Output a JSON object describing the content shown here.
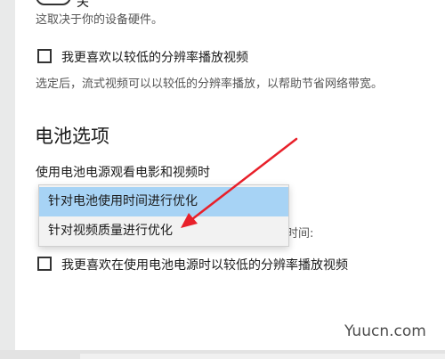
{
  "settings": {
    "toggle_state": "关",
    "hardware_note": "这取决于你的设备硬件。",
    "low_res_checkbox_label": "我更喜欢以较低的分辨率播放视频",
    "low_res_description": "选定后，流式视频可以以较低的分辨率播放，以帮助节省网络带宽。"
  },
  "battery": {
    "heading": "电池选项",
    "dropdown_label": "使用电池电源观看电影和视频时",
    "options": [
      "针对电池使用时间进行优化",
      "针对视频质量进行优化"
    ],
    "selected_index": 0,
    "obscured_text_tail": "时间:",
    "battery_checkbox_label": "我更喜欢在使用电池电源时以较低的分辨率播放视频"
  },
  "annotation": {
    "arrow_color": "#e8202a"
  },
  "watermark": "Yuucn.com"
}
